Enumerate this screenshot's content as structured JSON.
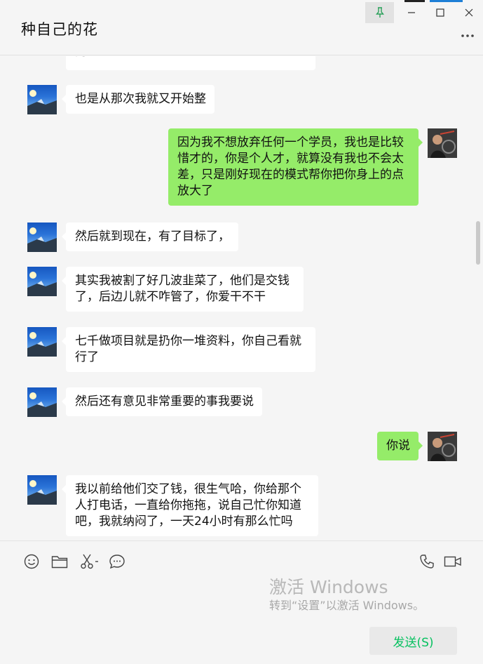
{
  "window": {
    "title": "种自己的花"
  },
  "messages": [
    {
      "side": "in",
      "text": "的"
    },
    {
      "side": "in",
      "text": "也是从那次我就又开始整"
    },
    {
      "side": "out",
      "text": "因为我不想放弃任何一个学员，我也是比较惜才的，你是个人才，就算没有我也不会太差，只是刚好现在的模式帮你把你身上的点放大了"
    },
    {
      "side": "in",
      "text": "然后就到现在，有了目标了，"
    },
    {
      "side": "in",
      "text": "其实我被割了好几波韭菜了，他们是交钱了，后边儿就不咋管了，你爱干不干"
    },
    {
      "side": "in",
      "text": "七千做项目就是扔你一堆资料，你自己看就行了"
    },
    {
      "side": "in",
      "text": "然后还有意见非常重要的事我要说"
    },
    {
      "side": "out",
      "text": "你说"
    },
    {
      "side": "in",
      "text": "我以前给他们交了钱，很生气哈，你给那个人打电话，一直给你拖拖，说自己忙你知道吧，我就纳闷了，一天24小时有那么忙吗"
    }
  ],
  "toolbar": {
    "left_icons": [
      "emoji-icon",
      "folder-icon",
      "scissors-icon",
      "chat-bubble-icon"
    ],
    "right_icons": [
      "phone-icon",
      "video-icon"
    ]
  },
  "watermark": {
    "line1": "激活 Windows",
    "line2": "转到“设置”以激活 Windows。"
  },
  "send_button": {
    "label": "发送(S)"
  },
  "colors": {
    "incoming_bubble": "#ffffff",
    "outgoing_bubble": "#95ec69",
    "send_text": "#07c160",
    "background": "#f5f5f5"
  }
}
